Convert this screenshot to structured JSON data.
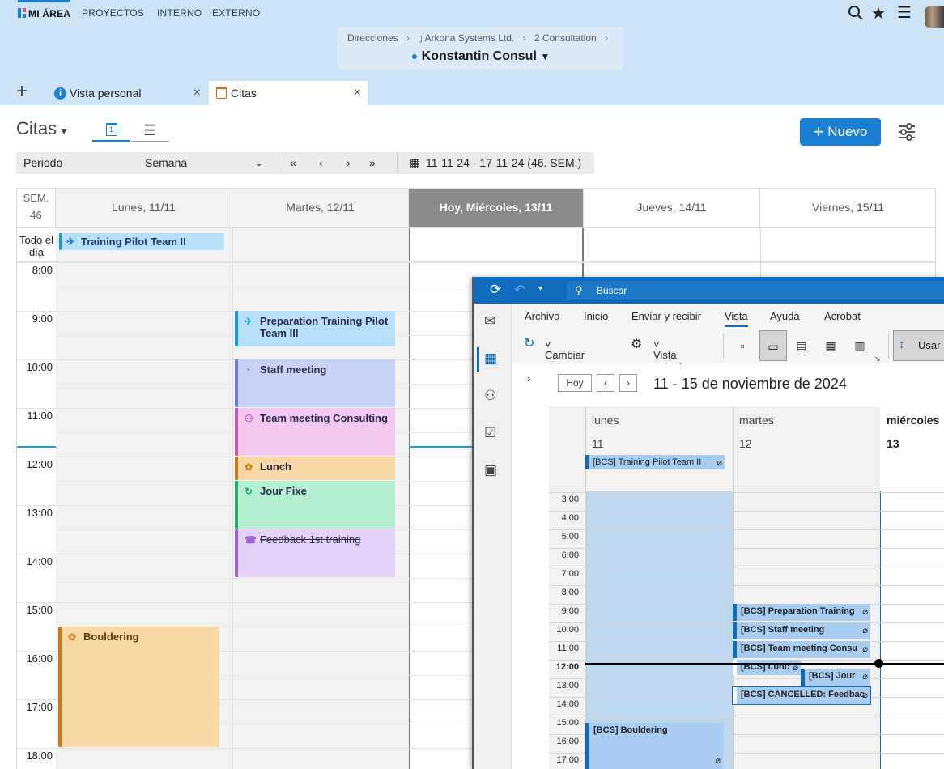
{
  "topnav": {
    "tabs": [
      "MI ÁREA",
      "PROYECTOS",
      "INTERNO",
      "EXTERNO"
    ],
    "breadcrumb": [
      "Direcciones",
      "Arkona Systems Ltd.",
      "2 Consultation"
    ],
    "breadcrumb_sep": "›",
    "person": "Konstantin Consul"
  },
  "tabs": [
    {
      "label": "Vista personal",
      "icon": "info-icon"
    },
    {
      "label": "Citas",
      "icon": "calendar-icon"
    }
  ],
  "toolbar": {
    "title": "Citas",
    "new_label": "Nuevo",
    "period_label": "Periodo",
    "period_value": "Semana",
    "date_range": "11-11-24 - 17-11-24 (46. SEM.)"
  },
  "calendar": {
    "week_label": "SEM.",
    "week_num": "46",
    "allday_label": "Todo el día",
    "days": [
      "Lunes, 11/11",
      "Martes, 12/11",
      "Hoy, Miércoles, 13/11",
      "Jueves, 14/11",
      "Viernes, 15/11"
    ],
    "hours": [
      "8:00",
      "9:00",
      "10:00",
      "11:00",
      "12:00",
      "13:00",
      "14:00",
      "15:00",
      "16:00",
      "17:00",
      "18:00"
    ],
    "allday_event": "Training Pilot Team II",
    "events": [
      {
        "title": "Preparation Training Pilot Team III",
        "color": "#b7e0fb",
        "border": "#1b9ad8",
        "icon": "tool-icon"
      },
      {
        "title": "Staff meeting",
        "color": "#c6d3f7",
        "border": "#6d7fd8",
        "icon": "clock-icon"
      },
      {
        "title": "Team meeting Consulting",
        "color": "#f5c8f0",
        "border": "#c05ab8",
        "icon": "people-icon"
      },
      {
        "title": "Lunch",
        "color": "#f8d8a4",
        "border": "#c77d17",
        "icon": "food-icon"
      },
      {
        "title": "Jour Fixe",
        "color": "#b4efd1",
        "border": "#27a968",
        "icon": "repeat-icon"
      },
      {
        "title": "Feedback 1st training",
        "color": "#e4d2f8",
        "border": "#9a63d6",
        "icon": "phone-icon"
      },
      {
        "title": "Bouldering",
        "color": "#f8d8a4",
        "border": "#c77d17",
        "icon": "food-icon"
      }
    ]
  },
  "outlook": {
    "search": "Buscar",
    "menu": [
      "Archivo",
      "Inicio",
      "Enviar y recibir",
      "Vista",
      "Ayuda",
      "Acrobat"
    ],
    "ribbon_change_view": "Cambiar vista",
    "ribbon_current_view": "Vista actual",
    "ribbon_use": "Usar",
    "today_btn": "Hoy",
    "range": "11 - 15 de noviembre de 2024",
    "days": [
      {
        "name": "lunes",
        "num": "11"
      },
      {
        "name": "martes",
        "num": "12"
      },
      {
        "name": "miércoles",
        "num": "13"
      }
    ],
    "hours": [
      "3:00",
      "4:00",
      "5:00",
      "6:00",
      "7:00",
      "8:00",
      "9:00",
      "10:00",
      "11:00",
      "12:00",
      "13:00",
      "14:00",
      "15:00",
      "16:00",
      "17:00"
    ],
    "allday_event": "[BCS] Training Pilot Team II",
    "events": [
      "[BCS] Preparation Training",
      "[BCS] Staff meeting",
      "[BCS] Team meeting Consu",
      "[BCS] Lunc",
      "[BCS] Jour",
      "[BCS] CANCELLED: Feedbac",
      "[BCS] Bouldering"
    ]
  }
}
